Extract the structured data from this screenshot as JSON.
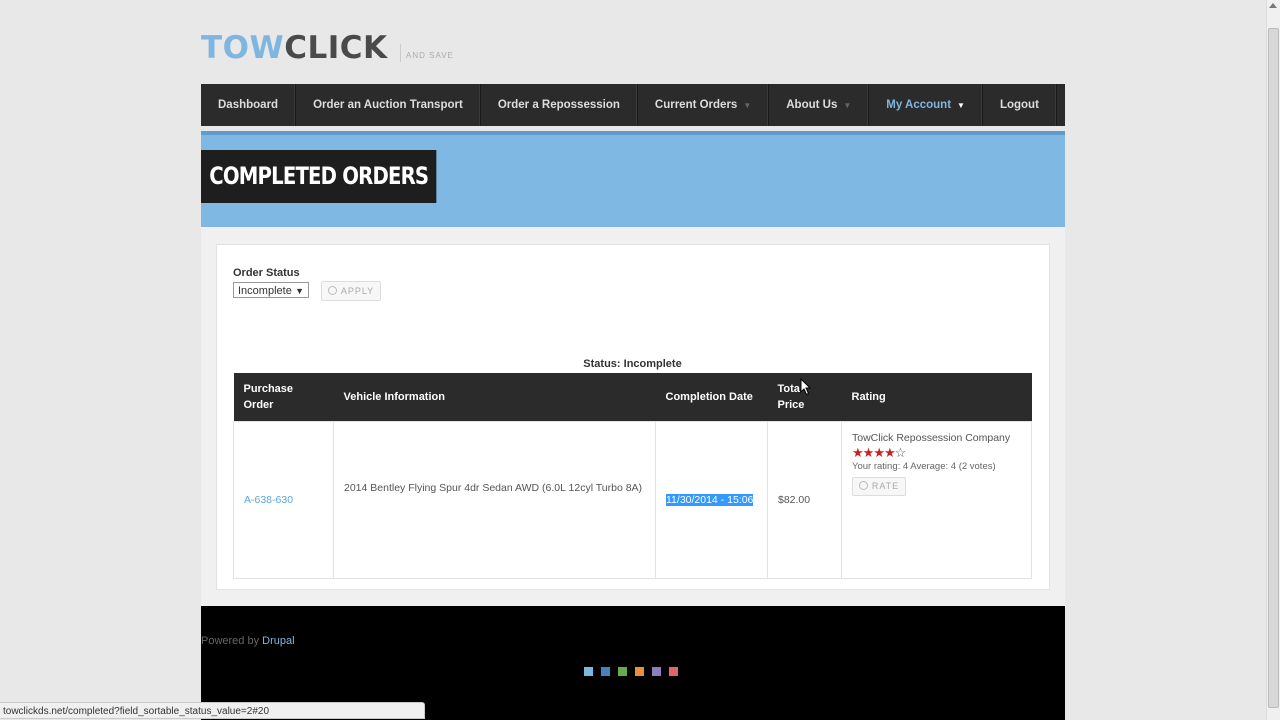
{
  "logo": {
    "part1": "TOW",
    "part2": "CLICK",
    "slogan": "AND SAVE"
  },
  "nav": {
    "items": [
      {
        "label": "Dashboard",
        "dropdown": false
      },
      {
        "label": "Order an Auction Transport",
        "dropdown": false
      },
      {
        "label": "Order a Repossession",
        "dropdown": false
      },
      {
        "label": "Current Orders",
        "dropdown": true
      },
      {
        "label": "About Us",
        "dropdown": true
      },
      {
        "label": "My Account",
        "dropdown": true,
        "active": true
      },
      {
        "label": "Logout",
        "dropdown": false
      }
    ]
  },
  "page": {
    "title": "COMPLETED ORDERS"
  },
  "filter": {
    "label": "Order Status",
    "selected": "Incomplete",
    "apply_label": "APPLY"
  },
  "table": {
    "caption": "Status: Incomplete",
    "headers": {
      "po": "Purchase Order",
      "vehicle": "Vehicle Information",
      "date": "Completion Date",
      "price": "Total Price",
      "rating": "Rating"
    },
    "rows": [
      {
        "po": "A-638-630",
        "vehicle": "2014 Bentley Flying Spur 4dr Sedan AWD (6.0L 12cyl Turbo 8A)",
        "date": "11/30/2014 - 15:06",
        "price": "$82.00",
        "rating_company": "TowClick Repossession Company",
        "stars": 4,
        "stars_max": 5,
        "rating_info": "Your rating: 4 Average: 4 (2 votes)",
        "rate_label": "RATE"
      }
    ]
  },
  "footer": {
    "powered_prefix": "Powered by ",
    "powered_link": "Drupal",
    "swatches": [
      "#7fb6e0",
      "#4a7fc0",
      "#6aa84f",
      "#e69138",
      "#8e7cc3",
      "#e06666"
    ]
  },
  "statusbar": {
    "url": "towclickds.net/completed?field_sortable_status_value=2#20"
  },
  "colors": {
    "accent": "#7fb6e0",
    "nav_bg": "#2b2b2b",
    "banner": "#7fb8e2",
    "footer": "#000000"
  }
}
